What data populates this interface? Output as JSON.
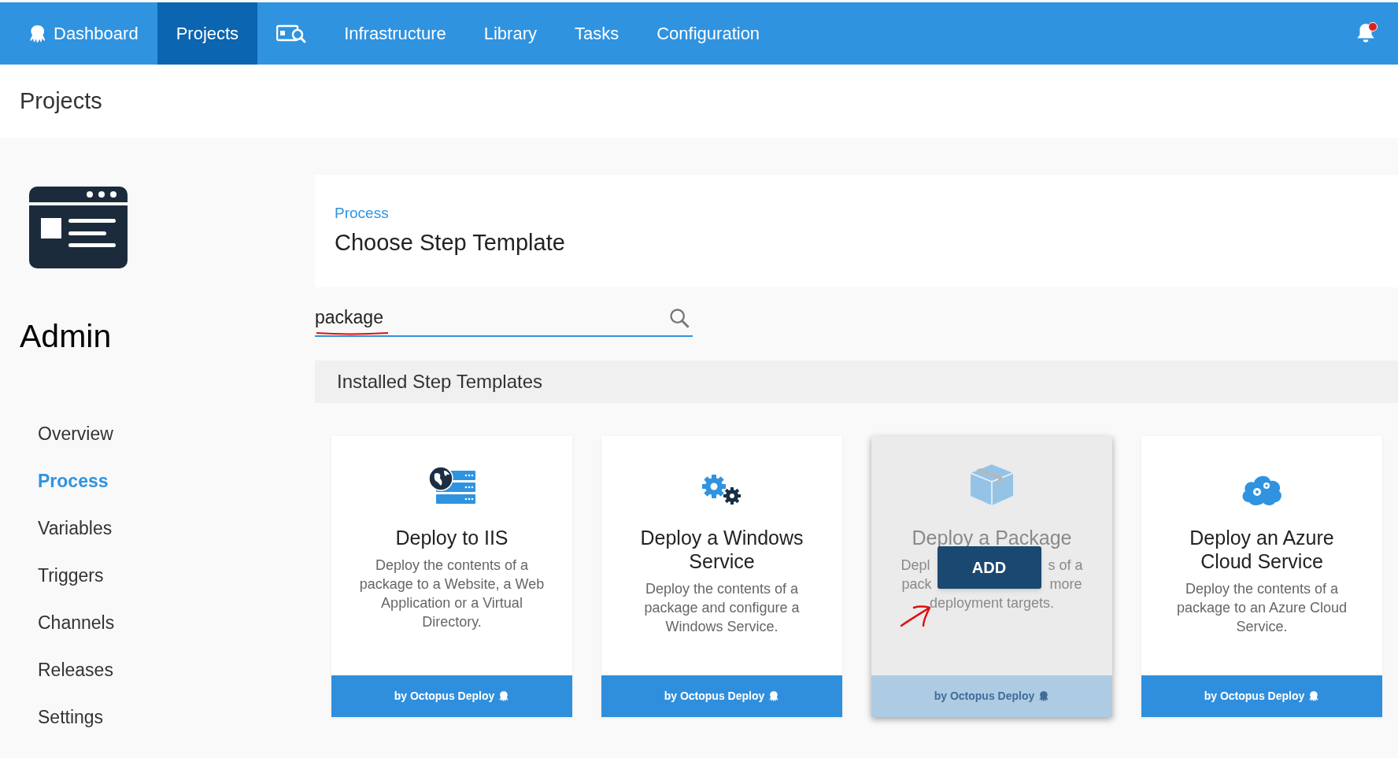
{
  "nav": {
    "items": [
      {
        "kind": "logo",
        "label": "Dashboard",
        "selected": false
      },
      {
        "kind": "text",
        "label": "Projects",
        "selected": true
      },
      {
        "kind": "search-icon",
        "selected": false
      },
      {
        "kind": "text",
        "label": "Infrastructure",
        "selected": false
      },
      {
        "kind": "text",
        "label": "Library",
        "selected": false
      },
      {
        "kind": "text",
        "label": "Tasks",
        "selected": false
      },
      {
        "kind": "text",
        "label": "Configuration",
        "selected": false
      }
    ],
    "notification": true
  },
  "page_title": "Projects",
  "sidebar": {
    "project_name": "Admin",
    "items": [
      {
        "label": "Overview",
        "selected": false
      },
      {
        "label": "Process",
        "selected": true
      },
      {
        "label": "Variables",
        "selected": false
      },
      {
        "label": "Triggers",
        "selected": false
      },
      {
        "label": "Channels",
        "selected": false
      },
      {
        "label": "Releases",
        "selected": false
      },
      {
        "label": "Settings",
        "selected": false
      }
    ]
  },
  "header": {
    "breadcrumb": "Process",
    "title": "Choose Step Template"
  },
  "search": {
    "value": "package"
  },
  "section_title": "Installed Step Templates",
  "cards": [
    {
      "kind": "iis",
      "title": "Deploy to IIS",
      "description": "Deploy the contents of a package to a Website, a Web Application or a Virtual Directory.",
      "author": "by Octopus Deploy",
      "hovered": false
    },
    {
      "kind": "windows",
      "title": "Deploy a Windows Service",
      "description": "Deploy the contents of a package and configure a Windows Service.",
      "author": "by Octopus Deploy",
      "hovered": false
    },
    {
      "kind": "package",
      "title": "Deploy a Package",
      "visible_lines": [
        [
          "Depl",
          "s of a"
        ],
        [
          "pack",
          "more"
        ],
        [
          "deployment targets."
        ]
      ],
      "button": "ADD",
      "author": "by Octopus Deploy",
      "hovered": true
    },
    {
      "kind": "azure",
      "title": "Deploy an Azure Cloud Service",
      "description": "Deploy the contents of a package to an Azure Cloud Service.",
      "author": "by Octopus Deploy",
      "hovered": false
    }
  ]
}
